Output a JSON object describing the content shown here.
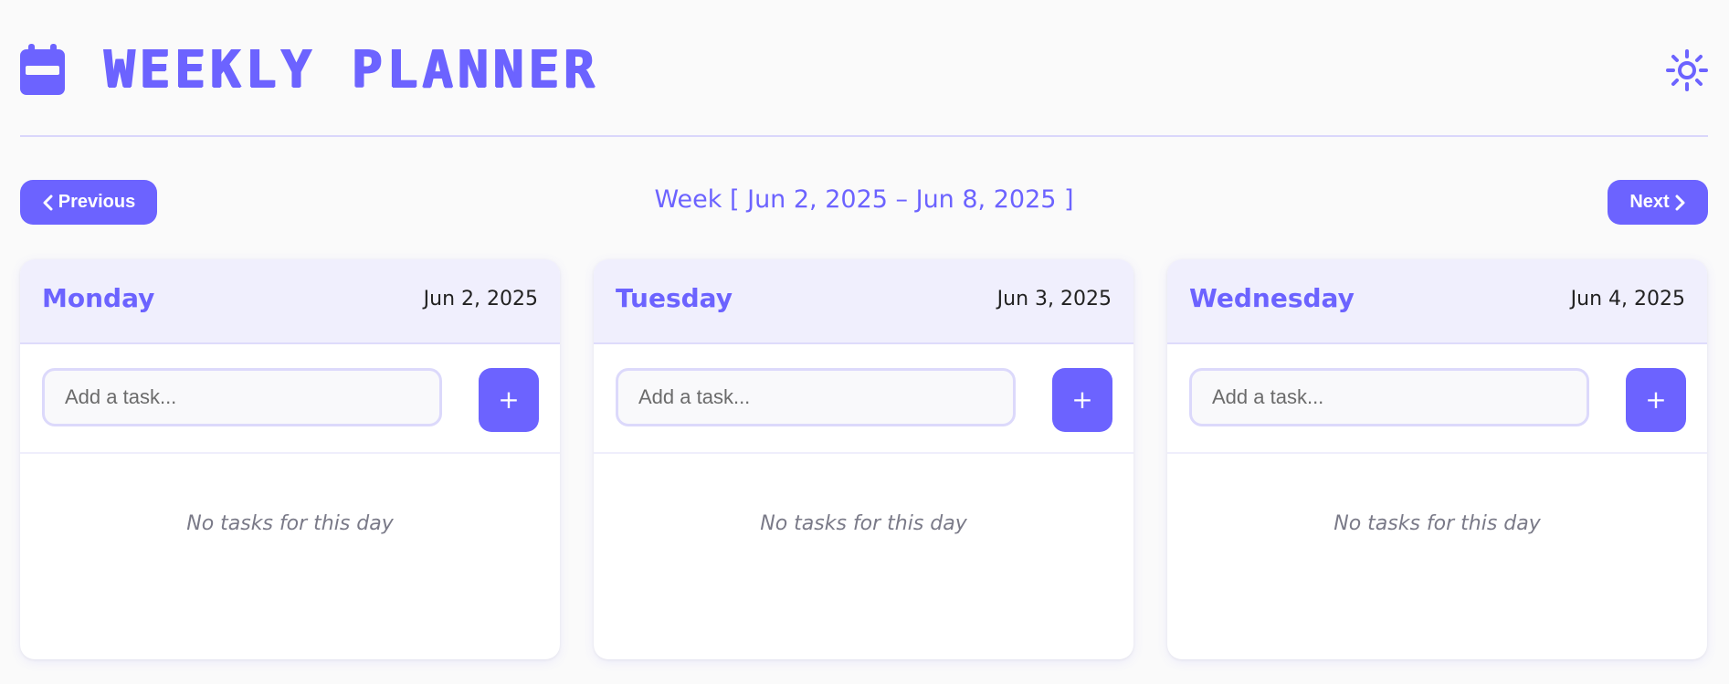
{
  "header": {
    "title": "WEEKLY PLANNER",
    "logo_icon": "calendar-icon",
    "theme_toggle_icon": "sun-icon"
  },
  "week_nav": {
    "previous_label": "Previous",
    "next_label": "Next",
    "week_label": "Week [ Jun 2, 2025 – Jun 8, 2025 ]"
  },
  "days": [
    {
      "name": "Monday",
      "date": "Jun 2, 2025",
      "task_placeholder": "Add a task...",
      "add_label": "+",
      "empty_message": "No tasks for this day"
    },
    {
      "name": "Tuesday",
      "date": "Jun 3, 2025",
      "task_placeholder": "Add a task...",
      "add_label": "+",
      "empty_message": "No tasks for this day"
    },
    {
      "name": "Wednesday",
      "date": "Jun 4, 2025",
      "task_placeholder": "Add a task...",
      "add_label": "+",
      "empty_message": "No tasks for this day"
    }
  ],
  "colors": {
    "accent": "#6c63ff",
    "header_bg": "#f0effd",
    "page_bg": "#fafafa",
    "border": "#dcd9fb"
  }
}
